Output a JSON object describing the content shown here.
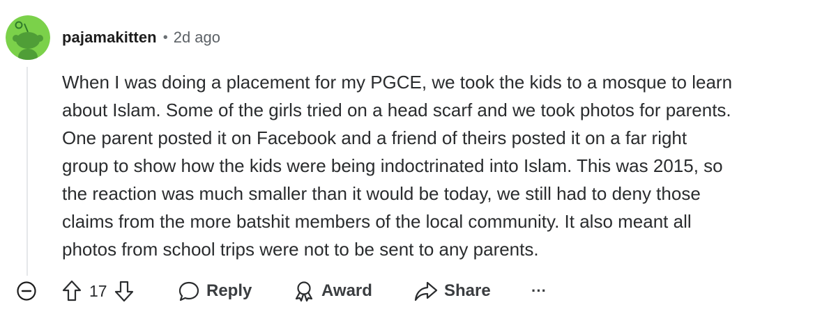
{
  "comment": {
    "author": "pajamakitten",
    "separator": "•",
    "age": "2d ago",
    "body_lines": [
      "When I was doing a placement for my PGCE, we took the kids to a mosque to learn",
      "about Islam. Some of the girls tried on a head scarf and we took photos for parents.",
      "One parent posted it on Facebook and a friend of theirs posted it on a far right",
      "group to show how the kids were being indoctrinated into Islam. This was 2015, so",
      "the reaction was much smaller than it would be today, we still had to deny those",
      "claims from the more batshit members of the local community. It also meant all",
      "photos from school trips were not to be sent to any parents."
    ],
    "avatar_color": "#7bd14a"
  },
  "actions": {
    "collapse_icon": "minus-circle-icon",
    "upvote_icon": "arrow-up-icon",
    "score": "17",
    "downvote_icon": "arrow-down-icon",
    "reply_label": "Reply",
    "award_label": "Award",
    "share_label": "Share",
    "more_label": "···"
  }
}
